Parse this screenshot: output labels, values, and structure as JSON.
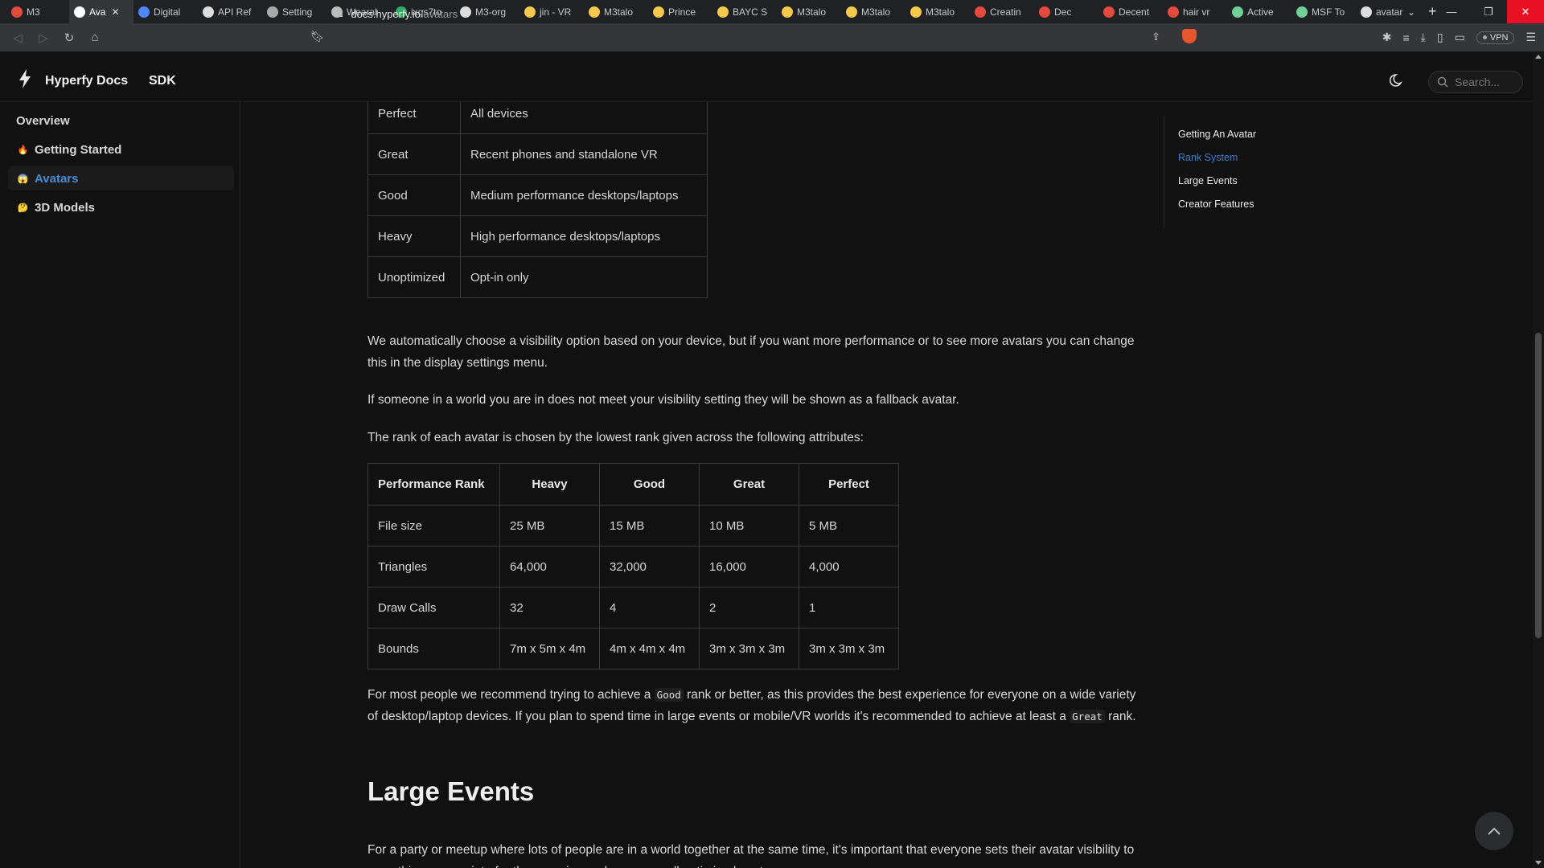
{
  "browser": {
    "tabs": [
      {
        "label": "M3",
        "color": "#e24a3b"
      },
      {
        "label": "Ava",
        "color": "#ffffff",
        "active": true
      },
      {
        "label": "Digital",
        "color": "#4f86f7"
      },
      {
        "label": "API Ref",
        "color": "#dddddd"
      },
      {
        "label": "Setting",
        "color": "#aaaaaa"
      },
      {
        "label": "Wearal",
        "color": "#bbbbbb"
      },
      {
        "label": "ixqs7to",
        "color": "#33aa66"
      },
      {
        "label": "M3-org",
        "color": "#dddddd"
      },
      {
        "label": "jin - VR",
        "color": "#f2c94c"
      },
      {
        "label": "M3talo",
        "color": "#f2c94c"
      },
      {
        "label": "Prince",
        "color": "#f2c94c"
      },
      {
        "label": "BAYC S",
        "color": "#f2c94c"
      },
      {
        "label": "M3talo",
        "color": "#f2c94c"
      },
      {
        "label": "M3talo",
        "color": "#f2c94c"
      },
      {
        "label": "M3talo",
        "color": "#f2c94c"
      },
      {
        "label": "Creatin",
        "color": "#e24a3b"
      },
      {
        "label": "Dec",
        "color": "#e24a3b"
      },
      {
        "label": "Decent",
        "color": "#e24a3b"
      },
      {
        "label": "hair vr",
        "color": "#e24a3b"
      },
      {
        "label": "Active",
        "color": "#6fcf97"
      },
      {
        "label": "MSF To",
        "color": "#6fcf97"
      },
      {
        "label": "avatar",
        "color": "#dddddd"
      }
    ],
    "url_host": "docs.hyperfy.io",
    "url_path": "/avatars",
    "vpn_label": "VPN"
  },
  "header": {
    "title": "Hyperfy Docs",
    "sdk": "SDK",
    "search_placeholder": "Search..."
  },
  "sidebar": {
    "items": [
      {
        "label": "Overview"
      },
      {
        "label": "Getting Started",
        "emoji": "🔥"
      },
      {
        "label": "Avatars",
        "emoji": "😱"
      },
      {
        "label": "3D Models",
        "emoji": "🤔"
      }
    ]
  },
  "toc": {
    "items": [
      "Getting An Avatar",
      "Rank System",
      "Large Events",
      "Creator Features"
    ]
  },
  "visibility_table": {
    "rows": [
      {
        "rank": "Perfect",
        "devices": "All devices"
      },
      {
        "rank": "Great",
        "devices": "Recent phones and standalone VR"
      },
      {
        "rank": "Good",
        "devices": "Medium performance desktops/laptops"
      },
      {
        "rank": "Heavy",
        "devices": "High performance desktops/laptops"
      },
      {
        "rank": "Unoptimized",
        "devices": "Opt-in only"
      }
    ]
  },
  "paragraphs": {
    "p1": "We automatically choose a visibility option based on your device, but if you want more performance or to see more avatars you can change this in the display settings menu.",
    "p2": "If someone in a world you are in does not meet your visibility setting they will be shown as a fallback avatar.",
    "p3": "The rank of each avatar is chosen by the lowest rank given across the following attributes:",
    "p4_a": "For most people we recommend trying to achieve a ",
    "p4_code1": "Good",
    "p4_b": " rank or better, as this provides the best experience for everyone on a wide variety of desktop/laptop devices. If you plan to spend time in large events or mobile/VR worlds it's recommended to achieve at least a ",
    "p4_code2": "Great",
    "p4_c": " rank.",
    "h_large_events": "Large Events",
    "p5": "For a party or meetup where lots of people are in a world together at the same time, it's important that everyone sets their avatar visibility to something appropriate for the occasion and wears a well optimized avatar."
  },
  "rank_table": {
    "headers": [
      "Performance Rank",
      "Heavy",
      "Good",
      "Great",
      "Perfect"
    ],
    "rows": [
      [
        "File size",
        "25 MB",
        "15 MB",
        "10 MB",
        "5 MB"
      ],
      [
        "Triangles",
        "64,000",
        "32,000",
        "16,000",
        "4,000"
      ],
      [
        "Draw Calls",
        "32",
        "4",
        "2",
        "1"
      ],
      [
        "Bounds",
        "7m x 5m x 4m",
        "4m x 4m x 4m",
        "3m x 3m x 3m",
        "3m x 3m x 3m"
      ]
    ]
  }
}
